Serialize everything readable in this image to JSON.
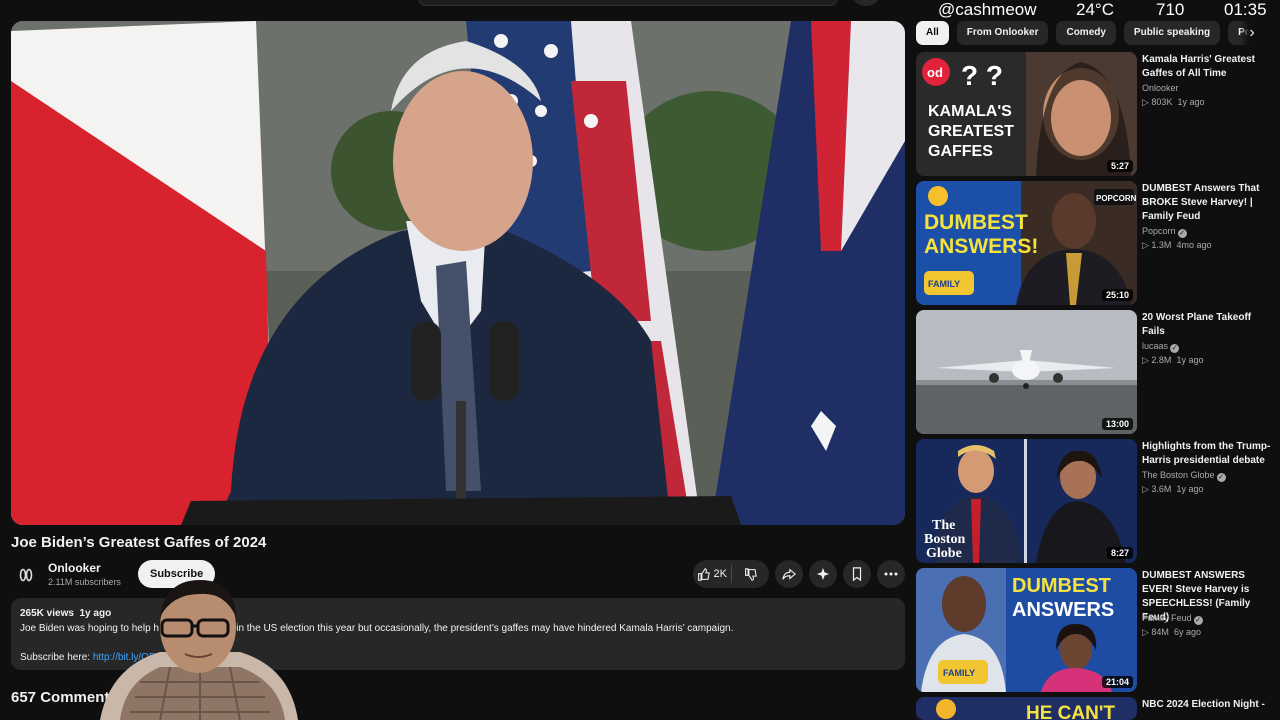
{
  "overlay": {
    "handle": "@cashmeow",
    "temperature": "24°C",
    "count": "710",
    "time": "01:35"
  },
  "video": {
    "title": "Joe Biden’s Greatest Gaffes of 2024",
    "channel": "Onlooker",
    "subscribers": "2.11M subscribers",
    "subscribe_label": "Subscribe",
    "likes": "2K"
  },
  "description": {
    "views": "265K views",
    "age": "1y ago",
    "text_start": "Joe Biden was hoping to help h",
    "text_end": "win the US election this year but occasionally, the president’s gaffes may have hindered Kamala Harris’ campaign.",
    "subscribe_prefix": "Subscribe here:",
    "link": "http://bit.ly/ODN"
  },
  "comments_label": "657 Comments",
  "chips": [
    "All",
    "From Onlooker",
    "Comedy",
    "Public speaking",
    "Politic"
  ],
  "recommendations": [
    {
      "title": "Kamala Harris' Greatest Gaffes of All Time",
      "channel": "Onlooker",
      "views": "803K",
      "age": "1y ago",
      "duration": "5:27",
      "thumb_text": [
        "KAMALA'S",
        "GREATEST",
        "GAFFES"
      ]
    },
    {
      "title": "DUMBEST Answers That BROKE Steve Harvey! | Family Feud",
      "channel": "Popcorn",
      "views": "1.3M",
      "age": "4mo ago",
      "duration": "25:10",
      "thumb_text": [
        "DUMBEST",
        "ANSWERS!"
      ]
    },
    {
      "title": "20 Worst Plane Takeoff Fails",
      "channel": "lucaas",
      "views": "2.8M",
      "age": "1y ago",
      "duration": "13:00"
    },
    {
      "title": "Highlights from the Trump-Harris presidential debate",
      "channel": "The Boston Globe",
      "views": "3.6M",
      "age": "1y ago",
      "duration": "8:27",
      "thumb_text": [
        "The",
        "Boston",
        "Globe"
      ]
    },
    {
      "title": "DUMBEST ANSWERS EVER! Steve Harvey is SPEECHLESS! (Family Feud)",
      "channel": "Family Feud",
      "views": "84M",
      "age": "6y ago",
      "duration": "21:04",
      "thumb_text": [
        "DUMBEST",
        "ANSWERS"
      ]
    },
    {
      "title": "NBC 2024 Election Night -",
      "thumb_text": [
        "HE CAN'T"
      ]
    }
  ]
}
